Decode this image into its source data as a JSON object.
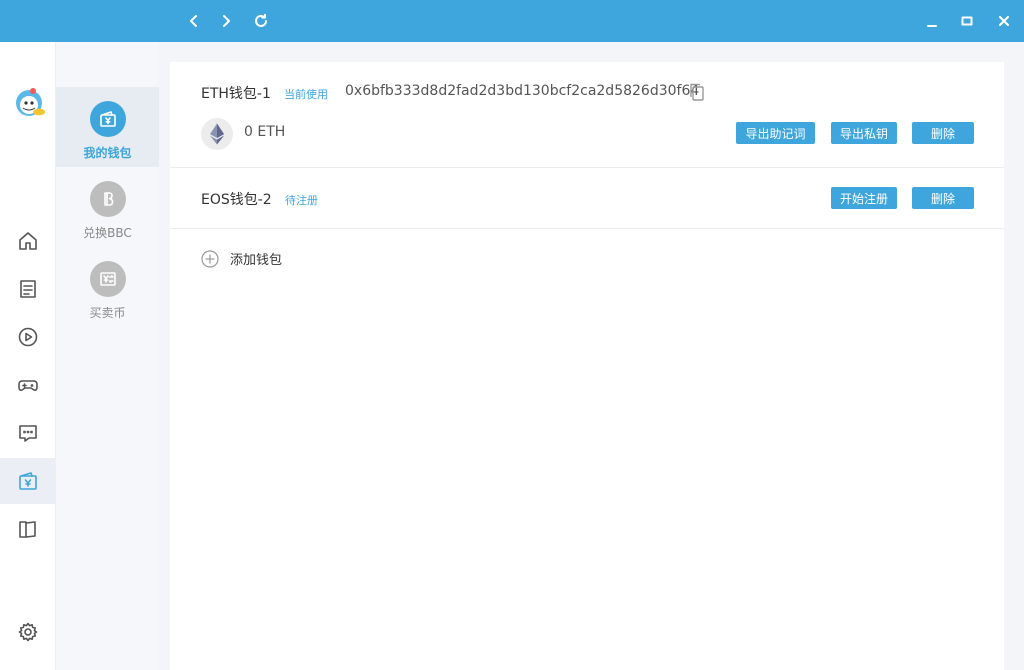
{
  "titlebar": {
    "back_icon": "chevron-left-icon",
    "forward_icon": "chevron-right-icon",
    "refresh_icon": "refresh-icon",
    "minimize_icon": "minimize-icon",
    "maximize_icon": "maximize-icon",
    "close_icon": "close-icon",
    "bg_color": "#3ea6dc"
  },
  "rail": {
    "items": [
      {
        "icon": "home-icon"
      },
      {
        "icon": "document-icon"
      },
      {
        "icon": "play-icon"
      },
      {
        "icon": "gamepad-icon"
      },
      {
        "icon": "chat-icon"
      },
      {
        "icon": "wallet-icon",
        "active": true
      },
      {
        "icon": "book-icon"
      }
    ],
    "settings_icon": "gear-icon"
  },
  "subnav": {
    "items": [
      {
        "label": "我的钱包",
        "icon": "wallet-icon",
        "active": true
      },
      {
        "label": "兑换BBC",
        "icon": "bbc-coin-icon"
      },
      {
        "label": "买卖币",
        "icon": "exchange-icon"
      }
    ]
  },
  "wallets": [
    {
      "name": "ETH钱包-1",
      "tag": "当前使用",
      "address": "0x6bfb333d8d2fad2d3bd130bcf2ca2d5826d30f64",
      "balance": "0 ETH",
      "coin_icon": "ethereum-icon",
      "buttons": [
        "导出助记词",
        "导出私钥",
        "删除"
      ]
    },
    {
      "name": "EOS钱包-2",
      "tag": "待注册",
      "buttons": [
        "开始注册",
        "删除"
      ]
    }
  ],
  "add_wallet": {
    "label": "添加钱包",
    "icon": "plus-circle-icon"
  },
  "colors": {
    "accent": "#3ea6dc"
  }
}
